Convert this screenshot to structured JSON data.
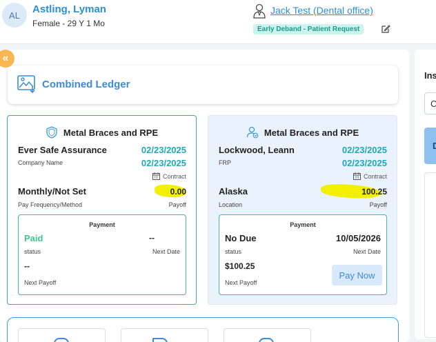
{
  "header": {
    "avatar_initials": "AL",
    "patient_name": "Astling, Lyman",
    "patient_sub": "Female - 29 Y 1 Mo",
    "doctor_link": "Jack Test (Dental office)",
    "status_tag": "Early Deband - Patient Request",
    "icons": {
      "doctor": "doctor-icon",
      "edit": "edit-icon"
    }
  },
  "nav": {
    "collapse_glyph": "«"
  },
  "ledger": {
    "title": "Combined Ledger",
    "icon": "image-ledger-icon"
  },
  "cards": [
    {
      "title": "Metal Braces and RPE",
      "icon": "shield-icon",
      "name": "Ever Safe Assurance",
      "name_label": "Company Name",
      "date1": "02/23/2025",
      "date2": "02/23/2025",
      "contract_label": "Contract",
      "field": "Monthly/Not Set",
      "field_label": "Pay Frequency/Method",
      "payoff_value": "0.00",
      "payoff_label": "Payoff",
      "payment": {
        "title": "Payment",
        "status_value": "Paid",
        "status_label": "status",
        "next_date_value": "--",
        "next_date_label": "Next Date",
        "next_payoff_value": "--",
        "next_payoff_label": "Next Payoff"
      }
    },
    {
      "title": "Metal Braces and RPE",
      "icon": "user-check-icon",
      "name": "Lockwood, Leann",
      "name_label": "FRP",
      "date1": "02/23/2025",
      "date2": "02/23/2025",
      "contract_label": "Contract",
      "field": "Alaska",
      "field_label": "Location",
      "payoff_value": "100.25",
      "payoff_label": "Payoff",
      "payment": {
        "title": "Payment",
        "status_value": "No Due",
        "status_label": "status",
        "next_date_value": "10/05/2026",
        "next_date_label": "Next Date",
        "next_payoff_value": "$100.25",
        "next_payoff_label": "Next Payoff",
        "pay_now_label": "Pay Now"
      }
    }
  ],
  "right_panel": {
    "label": "Ins",
    "select_value": "C",
    "blue_button": "D"
  },
  "colors": {
    "accent_blue": "#2b8fd6",
    "teal": "#1fa8b8",
    "paid_green": "#3fc78a",
    "highlight_yellow": "#f2f000",
    "collapse_orange": "#f7b851"
  }
}
